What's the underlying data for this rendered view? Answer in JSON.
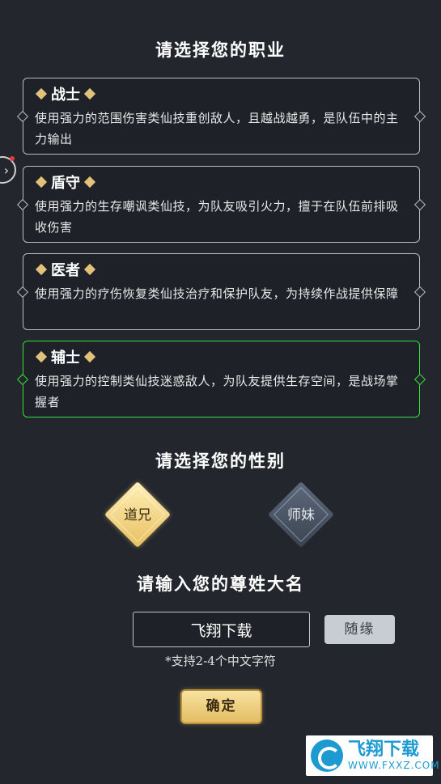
{
  "profession_heading": "请选择您的职业",
  "classes": [
    {
      "name": "战士",
      "description": "使用强力的范围伤害类仙技重创敌人，且越战越勇，是队伍中的主力输出"
    },
    {
      "name": "盾守",
      "description": "使用强力的生存嘲讽类仙技，为队友吸引火力，擅于在队伍前排吸收伤害"
    },
    {
      "name": "医者",
      "description": "使用强力的疗伤恢复类仙技治疗和保护队友，为持续作战提供保障"
    },
    {
      "name": "辅士",
      "description": "使用强力的控制类仙技迷惑敌人，为队友提供生存空间，是战场掌握者"
    }
  ],
  "selected_class": "辅士",
  "gender_heading": "请选择您的性别",
  "genders": {
    "male": "道兄",
    "female": "师妹"
  },
  "selected_gender": "道兄",
  "name_heading": "请输入您的尊姓大名",
  "name_input": {
    "value": "飞翔下载"
  },
  "random_button": "随缘",
  "hint": "*支持2-4个中文字符",
  "confirm_button": "确定",
  "watermark": {
    "title": "飞翔下载",
    "url": "WWW.FXXZ.COM"
  },
  "colors": {
    "background": "#23262d",
    "selected_border": "#35e03a",
    "gold": "#e2c27a"
  }
}
